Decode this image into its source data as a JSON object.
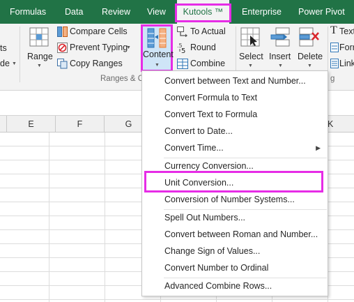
{
  "tabs": [
    {
      "label": "Formulas"
    },
    {
      "label": "Data"
    },
    {
      "label": "Review"
    },
    {
      "label": "View"
    },
    {
      "label": "Kutools ™"
    },
    {
      "label": "Enterprise"
    },
    {
      "label": "Power Pivot"
    }
  ],
  "ribbon": {
    "left_partial": [
      "ts",
      "de"
    ],
    "range_label": "Range",
    "compare_cells": "Compare Cells",
    "prevent_typing": "Prevent Typing",
    "copy_ranges": "Copy Ranges",
    "content_label": "Content",
    "to_actual": "To Actual",
    "round": "Round",
    "combine": "Combine",
    "select_label": "Select",
    "insert_label": "Insert",
    "delete_label": "Delete",
    "right_partial": [
      "Text",
      "Forr",
      "Link"
    ],
    "group_label": "Ranges & C",
    "group_label_right": "g"
  },
  "columns": [
    "E",
    "F",
    "G",
    "K"
  ],
  "menu": {
    "items": [
      "Convert between Text and Number...",
      "Convert Formula to Text",
      "Convert Text to Formula",
      "Convert to Date...",
      "Convert Time...",
      "Currency Conversion...",
      "Unit Conversion...",
      "Conversion of Number Systems...",
      "Spell Out Numbers...",
      "Convert between Roman and Number...",
      "Change Sign of Values...",
      "Convert Number to Ordinal",
      "Advanced Combine Rows..."
    ],
    "highlighted": "Unit Conversion..."
  },
  "colors": {
    "tab_bar": "#217346",
    "highlight": "#e62ce6",
    "ribbon_bg": "#f3f3f3"
  }
}
